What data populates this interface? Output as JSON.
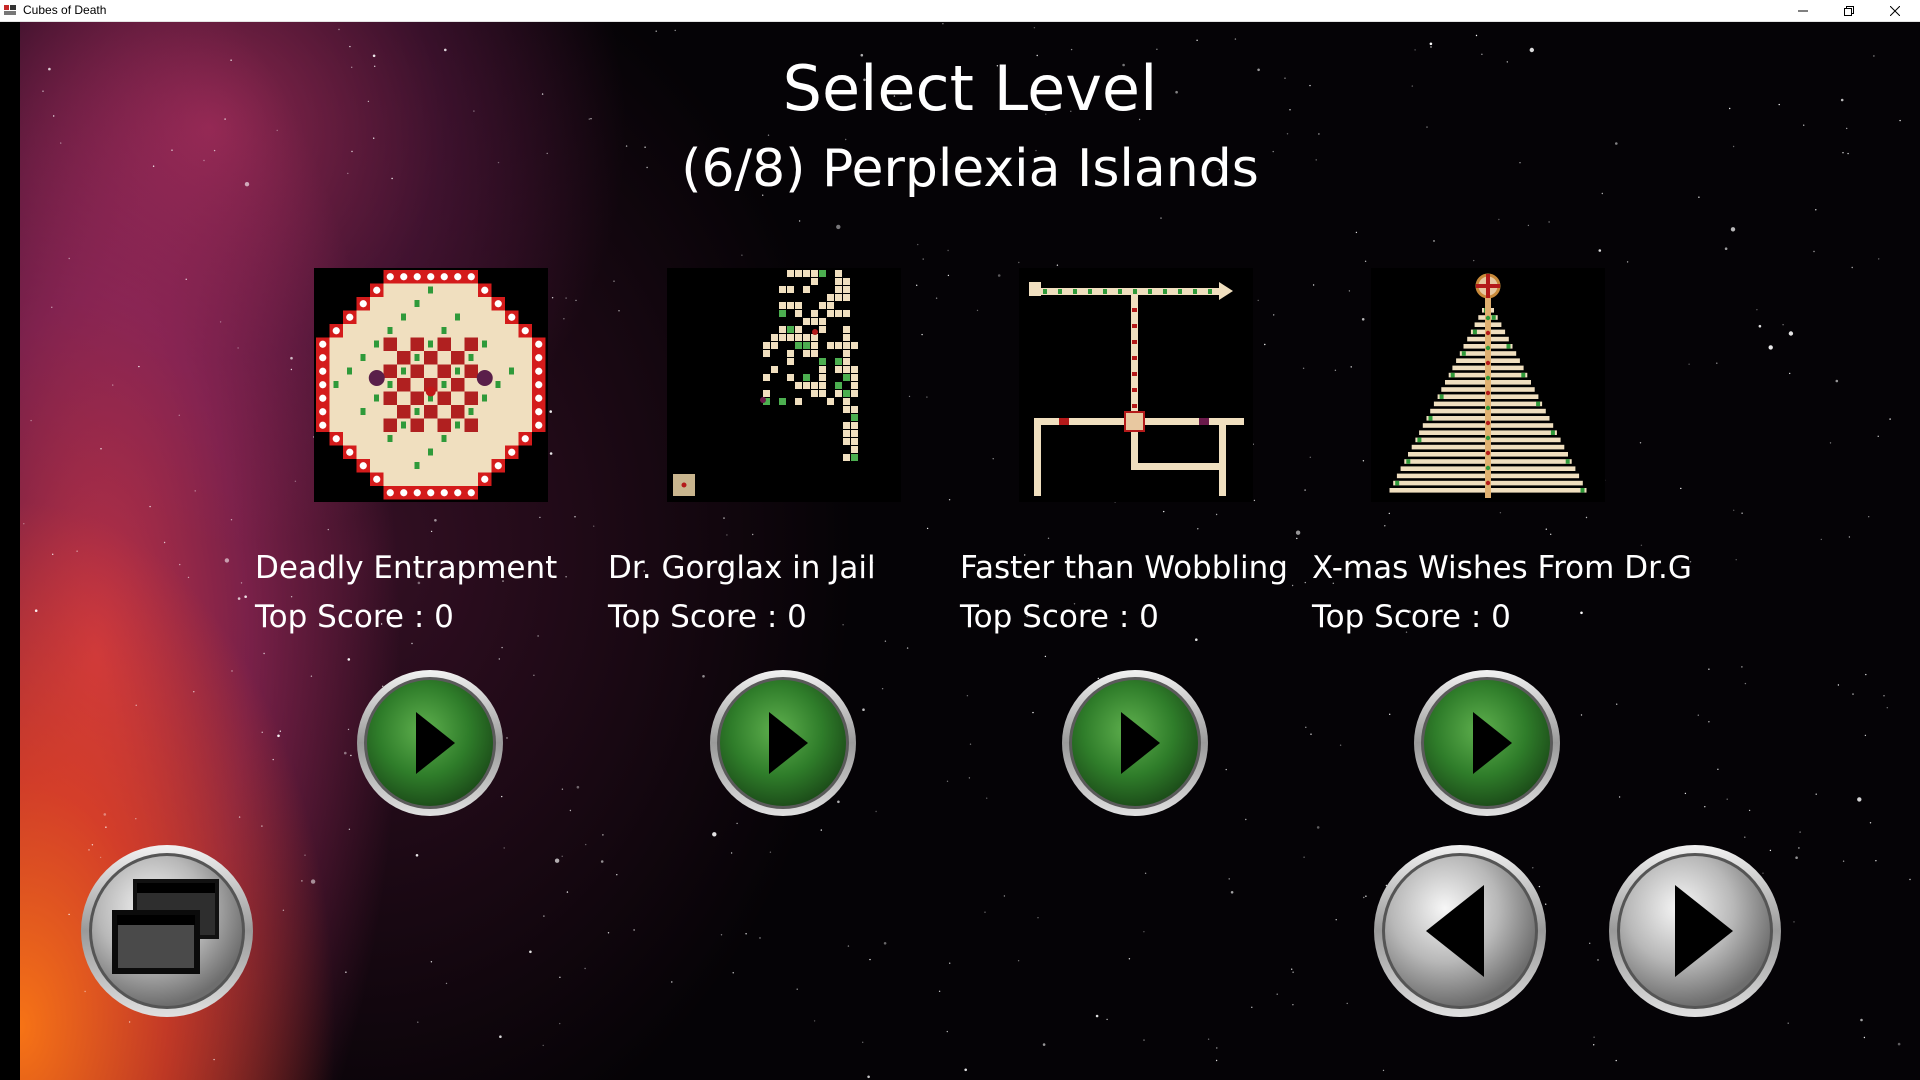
{
  "window": {
    "title": "Cubes of Death",
    "controls": [
      "minimize",
      "restore",
      "close"
    ]
  },
  "screen": {
    "title": "Select Level",
    "world": "(6/8) Perplexia Islands"
  },
  "levels": [
    {
      "name": "Deadly Entrapment",
      "score": "Top Score : 0",
      "thumbnail": "deadly-entrapment-map"
    },
    {
      "name": "Dr. Gorglax in Jail",
      "score": "Top Score : 0",
      "thumbnail": "dr-gorglax-jail-map"
    },
    {
      "name": "Faster than Wobbling",
      "score": "Top Score : 0",
      "thumbnail": "faster-than-wobbling-map"
    },
    {
      "name": "X-mas Wishes From Dr.G",
      "score": "Top Score : 0",
      "thumbnail": "xmas-tree-map"
    }
  ],
  "buttons": {
    "play_icon": "play-icon",
    "windowed_icon": "windowed-mode-icon",
    "prev_icon": "previous-page-icon",
    "next_icon": "next-page-icon"
  },
  "colors": {
    "play_green": "#2f7d2a",
    "button_silver": "#b8b8b8",
    "text": "#ffffff",
    "map_floor": "#f0dfbf",
    "map_wall": "#d41b1b"
  }
}
